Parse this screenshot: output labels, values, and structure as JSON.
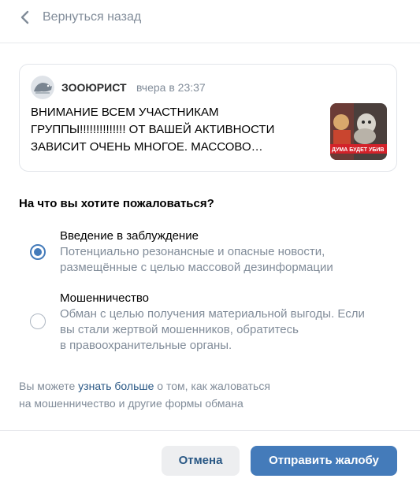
{
  "header": {
    "back_label": "Вернуться назад"
  },
  "post": {
    "author": "ЗООЮРИСТ",
    "time": "вчера в 23:37",
    "text_lines": [
      "ВНИМАНИЕ ВСЕМ УЧАСТНИКАМ",
      "ГРУППЫ!!!!!!!!!!!!!! ОТ ВАШЕЙ АКТИВНОСТИ",
      "ЗАВИСИТ ОЧЕНЬ МНОГОЕ. МАССОВО…"
    ],
    "thumbnail_caption": "ДУМА БУДЕТ УБИВ"
  },
  "question": "На что вы хотите пожаловаться?",
  "options": [
    {
      "title": "Введение в заблуждение",
      "description_lines": [
        "Потенциально резонансные и опасные новости,",
        "размещённые с целью массовой дезинформации"
      ],
      "selected": true
    },
    {
      "title": "Мошенничество",
      "description_lines": [
        "Обман с целью получения материальной выгоды. Если",
        "вы стали жертвой мошенников, обратитесь",
        "в правоохранительные органы."
      ],
      "selected": false
    }
  ],
  "info": {
    "prefix": "Вы можете ",
    "link": "узнать больше",
    "suffix_line1": " о том, как жаловаться",
    "line2": "на мошенничество и другие формы обмана"
  },
  "buttons": {
    "cancel": "Отмена",
    "submit": "Отправить жалобу"
  },
  "colors": {
    "accent": "#447bba",
    "link": "#2a5885",
    "secondary_text": "#818c99",
    "cancel_bg": "#edeef0"
  }
}
